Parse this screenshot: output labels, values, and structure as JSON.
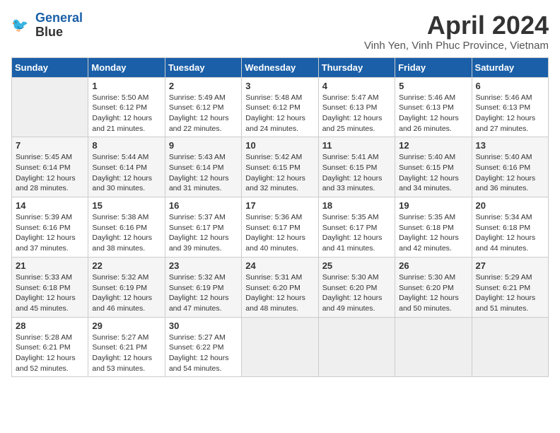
{
  "header": {
    "logo_line1": "General",
    "logo_line2": "Blue",
    "month": "April 2024",
    "location": "Vinh Yen, Vinh Phuc Province, Vietnam"
  },
  "weekdays": [
    "Sunday",
    "Monday",
    "Tuesday",
    "Wednesday",
    "Thursday",
    "Friday",
    "Saturday"
  ],
  "weeks": [
    [
      {
        "num": "",
        "empty": true
      },
      {
        "num": "1",
        "sunrise": "5:50 AM",
        "sunset": "6:12 PM",
        "daylight": "12 hours and 21 minutes."
      },
      {
        "num": "2",
        "sunrise": "5:49 AM",
        "sunset": "6:12 PM",
        "daylight": "12 hours and 22 minutes."
      },
      {
        "num": "3",
        "sunrise": "5:48 AM",
        "sunset": "6:12 PM",
        "daylight": "12 hours and 24 minutes."
      },
      {
        "num": "4",
        "sunrise": "5:47 AM",
        "sunset": "6:13 PM",
        "daylight": "12 hours and 25 minutes."
      },
      {
        "num": "5",
        "sunrise": "5:46 AM",
        "sunset": "6:13 PM",
        "daylight": "12 hours and 26 minutes."
      },
      {
        "num": "6",
        "sunrise": "5:46 AM",
        "sunset": "6:13 PM",
        "daylight": "12 hours and 27 minutes."
      }
    ],
    [
      {
        "num": "7",
        "sunrise": "5:45 AM",
        "sunset": "6:14 PM",
        "daylight": "12 hours and 28 minutes."
      },
      {
        "num": "8",
        "sunrise": "5:44 AM",
        "sunset": "6:14 PM",
        "daylight": "12 hours and 30 minutes."
      },
      {
        "num": "9",
        "sunrise": "5:43 AM",
        "sunset": "6:14 PM",
        "daylight": "12 hours and 31 minutes."
      },
      {
        "num": "10",
        "sunrise": "5:42 AM",
        "sunset": "6:15 PM",
        "daylight": "12 hours and 32 minutes."
      },
      {
        "num": "11",
        "sunrise": "5:41 AM",
        "sunset": "6:15 PM",
        "daylight": "12 hours and 33 minutes."
      },
      {
        "num": "12",
        "sunrise": "5:40 AM",
        "sunset": "6:15 PM",
        "daylight": "12 hours and 34 minutes."
      },
      {
        "num": "13",
        "sunrise": "5:40 AM",
        "sunset": "6:16 PM",
        "daylight": "12 hours and 36 minutes."
      }
    ],
    [
      {
        "num": "14",
        "sunrise": "5:39 AM",
        "sunset": "6:16 PM",
        "daylight": "12 hours and 37 minutes."
      },
      {
        "num": "15",
        "sunrise": "5:38 AM",
        "sunset": "6:16 PM",
        "daylight": "12 hours and 38 minutes."
      },
      {
        "num": "16",
        "sunrise": "5:37 AM",
        "sunset": "6:17 PM",
        "daylight": "12 hours and 39 minutes."
      },
      {
        "num": "17",
        "sunrise": "5:36 AM",
        "sunset": "6:17 PM",
        "daylight": "12 hours and 40 minutes."
      },
      {
        "num": "18",
        "sunrise": "5:35 AM",
        "sunset": "6:17 PM",
        "daylight": "12 hours and 41 minutes."
      },
      {
        "num": "19",
        "sunrise": "5:35 AM",
        "sunset": "6:18 PM",
        "daylight": "12 hours and 42 minutes."
      },
      {
        "num": "20",
        "sunrise": "5:34 AM",
        "sunset": "6:18 PM",
        "daylight": "12 hours and 44 minutes."
      }
    ],
    [
      {
        "num": "21",
        "sunrise": "5:33 AM",
        "sunset": "6:18 PM",
        "daylight": "12 hours and 45 minutes."
      },
      {
        "num": "22",
        "sunrise": "5:32 AM",
        "sunset": "6:19 PM",
        "daylight": "12 hours and 46 minutes."
      },
      {
        "num": "23",
        "sunrise": "5:32 AM",
        "sunset": "6:19 PM",
        "daylight": "12 hours and 47 minutes."
      },
      {
        "num": "24",
        "sunrise": "5:31 AM",
        "sunset": "6:20 PM",
        "daylight": "12 hours and 48 minutes."
      },
      {
        "num": "25",
        "sunrise": "5:30 AM",
        "sunset": "6:20 PM",
        "daylight": "12 hours and 49 minutes."
      },
      {
        "num": "26",
        "sunrise": "5:30 AM",
        "sunset": "6:20 PM",
        "daylight": "12 hours and 50 minutes."
      },
      {
        "num": "27",
        "sunrise": "5:29 AM",
        "sunset": "6:21 PM",
        "daylight": "12 hours and 51 minutes."
      }
    ],
    [
      {
        "num": "28",
        "sunrise": "5:28 AM",
        "sunset": "6:21 PM",
        "daylight": "12 hours and 52 minutes."
      },
      {
        "num": "29",
        "sunrise": "5:27 AM",
        "sunset": "6:21 PM",
        "daylight": "12 hours and 53 minutes."
      },
      {
        "num": "30",
        "sunrise": "5:27 AM",
        "sunset": "6:22 PM",
        "daylight": "12 hours and 54 minutes."
      },
      {
        "num": "",
        "empty": true
      },
      {
        "num": "",
        "empty": true
      },
      {
        "num": "",
        "empty": true
      },
      {
        "num": "",
        "empty": true
      }
    ]
  ],
  "labels": {
    "sunrise": "Sunrise:",
    "sunset": "Sunset:",
    "daylight": "Daylight:"
  }
}
